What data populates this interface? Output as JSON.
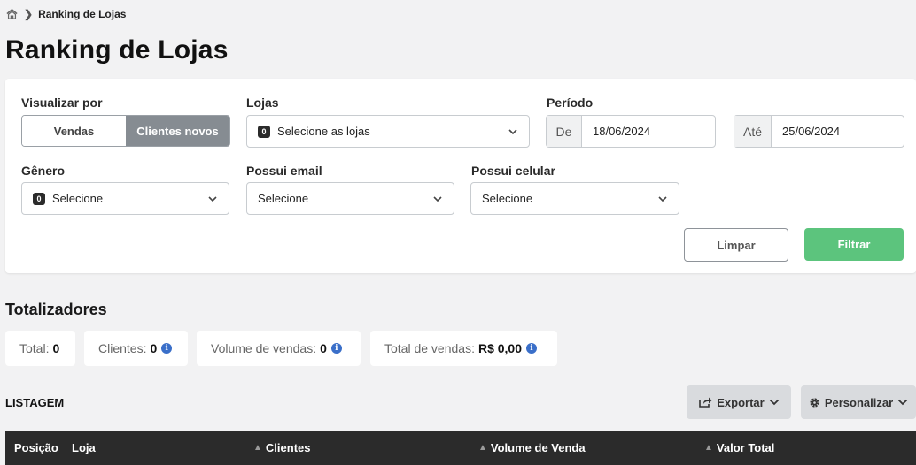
{
  "breadcrumb": {
    "current": "Ranking de Lojas"
  },
  "page_title": "Ranking de Lojas",
  "filters": {
    "view_by": {
      "label": "Visualizar por",
      "options": [
        "Vendas",
        "Clientes novos"
      ],
      "selected": "Clientes novos"
    },
    "stores": {
      "label": "Lojas",
      "badge": "0",
      "placeholder": "Selecione as lojas"
    },
    "period": {
      "label": "Período",
      "from_prefix": "De",
      "from_value": "18/06/2024",
      "to_prefix": "Até",
      "to_value": "25/06/2024"
    },
    "gender": {
      "label": "Gênero",
      "badge": "0",
      "placeholder": "Selecione"
    },
    "has_email": {
      "label": "Possui email",
      "value": "Selecione"
    },
    "has_mobile": {
      "label": "Possui celular",
      "value": "Selecione"
    },
    "clear_label": "Limpar",
    "filter_label": "Filtrar"
  },
  "totals": {
    "title": "Totalizadores",
    "items": [
      {
        "label": "Total:",
        "value": "0",
        "info": false
      },
      {
        "label": "Clientes:",
        "value": "0",
        "info": true
      },
      {
        "label": "Volume de vendas:",
        "value": "0",
        "info": true
      },
      {
        "label": "Total de vendas:",
        "value": "R$ 0,00",
        "info": true
      }
    ]
  },
  "listing": {
    "title": "LISTAGEM",
    "export_label": "Exportar",
    "customize_label": "Personalizar",
    "columns": [
      "Posição",
      "Loja",
      "Clientes",
      "Volume de Venda",
      "Valor Total"
    ]
  },
  "colors": {
    "primary_green": "#5cc47d",
    "toggle_active": "#868c92",
    "table_header": "#2b2b2b",
    "info_blue": "#3a6fc9"
  }
}
